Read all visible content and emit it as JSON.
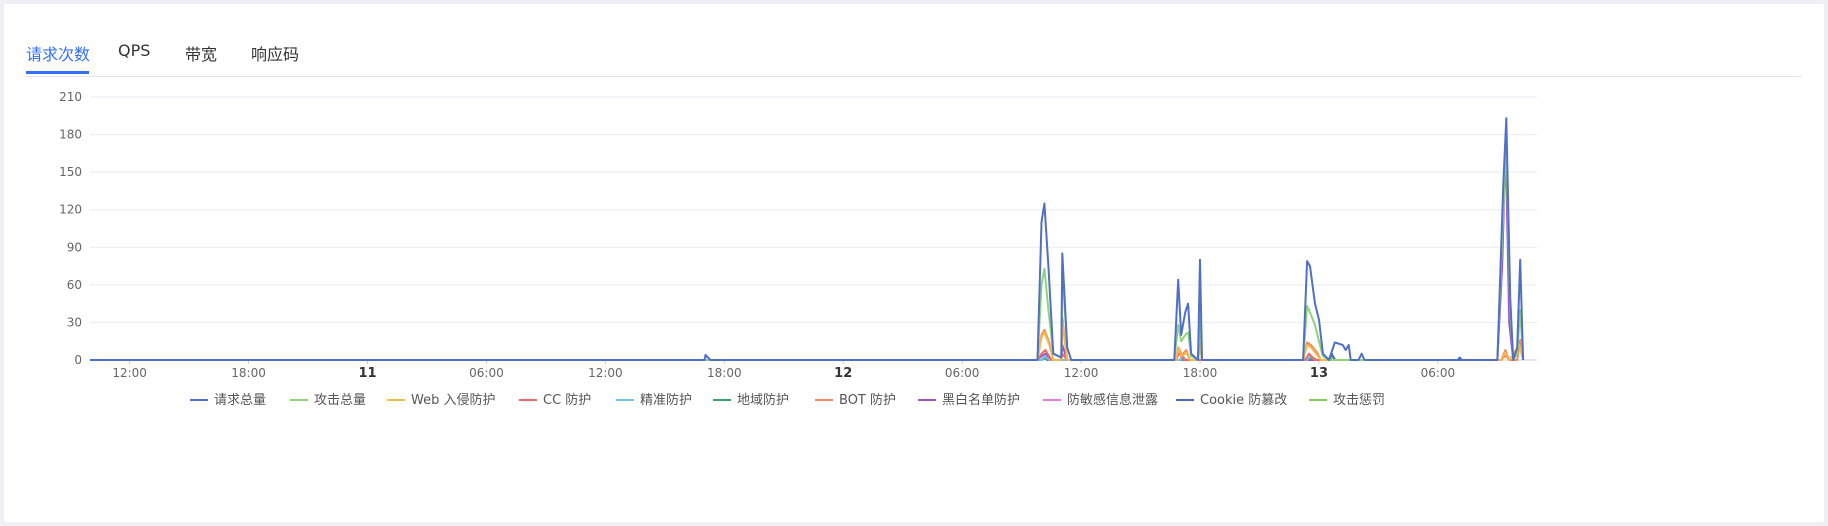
{
  "tabs": [
    {
      "label": "请求次数",
      "active": true
    },
    {
      "label": "QPS",
      "active": false
    },
    {
      "label": "带宽",
      "active": false
    },
    {
      "label": "响应码",
      "active": false
    }
  ],
  "colors": {
    "accent": "#3370ff",
    "grid": "#e8ebf0",
    "axis": "#c8ccd4"
  },
  "chart_data": {
    "type": "line",
    "y_ticks": [
      "0",
      "30",
      "60",
      "90",
      "120",
      "150",
      "180",
      "210"
    ],
    "ylim": [
      0,
      210
    ],
    "xlim": [
      0,
      60
    ],
    "x_ticks": [
      {
        "x": 2,
        "label": "12:00",
        "bold": false
      },
      {
        "x": 8,
        "label": "18:00",
        "bold": false
      },
      {
        "x": 14,
        "label": "11",
        "bold": true
      },
      {
        "x": 20,
        "label": "06:00",
        "bold": false
      },
      {
        "x": 26,
        "label": "12:00",
        "bold": false
      },
      {
        "x": 32,
        "label": "18:00",
        "bold": false
      },
      {
        "x": 38,
        "label": "12",
        "bold": true
      },
      {
        "x": 44,
        "label": "06:00",
        "bold": false
      },
      {
        "x": 50,
        "label": "12:00",
        "bold": false
      },
      {
        "x": 56,
        "label": "18:00",
        "bold": false
      },
      {
        "x": 62,
        "label": "13",
        "bold": true
      },
      {
        "x": 68,
        "label": "06:00",
        "bold": false
      }
    ],
    "series": [
      {
        "name": "请求总量",
        "color": "#4f6fc9",
        "points": [
          [
            0,
            0
          ],
          [
            31,
            0
          ],
          [
            31.05,
            4
          ],
          [
            31.3,
            0
          ],
          [
            47.8,
            0
          ],
          [
            48,
            110
          ],
          [
            48.15,
            125
          ],
          [
            48.35,
            75
          ],
          [
            48.6,
            5
          ],
          [
            49,
            2
          ],
          [
            49.05,
            85
          ],
          [
            49.3,
            10
          ],
          [
            49.5,
            0
          ],
          [
            54.7,
            0
          ],
          [
            54.9,
            64
          ],
          [
            55.05,
            20
          ],
          [
            55.25,
            38
          ],
          [
            55.4,
            45
          ],
          [
            55.55,
            5
          ],
          [
            55.9,
            0
          ],
          [
            56,
            80
          ],
          [
            56.1,
            0
          ],
          [
            61.2,
            0
          ],
          [
            61.4,
            79
          ],
          [
            61.55,
            75
          ],
          [
            61.8,
            45
          ],
          [
            62,
            32
          ],
          [
            62.2,
            5
          ],
          [
            62.5,
            0
          ],
          [
            62.8,
            14
          ],
          [
            63,
            13
          ],
          [
            63.2,
            12
          ],
          [
            63.35,
            8
          ],
          [
            63.5,
            12
          ],
          [
            63.6,
            0
          ],
          [
            64,
            0
          ],
          [
            64.15,
            5
          ],
          [
            64.3,
            0
          ],
          [
            71,
            0
          ],
          [
            71.3,
            140
          ],
          [
            71.45,
            193
          ],
          [
            71.65,
            50
          ],
          [
            71.8,
            0
          ],
          [
            72,
            10
          ],
          [
            72.15,
            80
          ],
          [
            72.3,
            0
          ]
        ]
      },
      {
        "name": "攻击总量",
        "color": "#8fd47a",
        "points": [
          [
            0,
            0
          ],
          [
            47.8,
            0
          ],
          [
            48,
            60
          ],
          [
            48.15,
            73
          ],
          [
            48.35,
            40
          ],
          [
            48.6,
            5
          ],
          [
            49,
            2
          ],
          [
            49.05,
            73
          ],
          [
            49.3,
            10
          ],
          [
            49.5,
            0
          ],
          [
            54.7,
            0
          ],
          [
            54.9,
            28
          ],
          [
            55.05,
            15
          ],
          [
            55.25,
            20
          ],
          [
            55.4,
            22
          ],
          [
            55.55,
            3
          ],
          [
            55.9,
            0
          ],
          [
            56,
            35
          ],
          [
            56.1,
            0
          ],
          [
            61.2,
            0
          ],
          [
            61.4,
            43
          ],
          [
            61.55,
            38
          ],
          [
            61.8,
            28
          ],
          [
            62,
            15
          ],
          [
            62.2,
            3
          ],
          [
            62.5,
            0
          ],
          [
            71,
            0
          ],
          [
            71.3,
            120
          ],
          [
            71.45,
            175
          ],
          [
            71.65,
            40
          ],
          [
            71.8,
            0
          ],
          [
            72,
            5
          ],
          [
            72.15,
            40
          ],
          [
            72.3,
            0
          ]
        ]
      },
      {
        "name": "Web 入侵防护",
        "color": "#f5b84b",
        "points": [
          [
            0,
            0
          ],
          [
            47.8,
            0
          ],
          [
            48,
            18
          ],
          [
            48.15,
            22
          ],
          [
            48.4,
            12
          ],
          [
            48.6,
            0
          ],
          [
            49,
            0
          ],
          [
            49.05,
            30
          ],
          [
            49.3,
            0
          ],
          [
            54.8,
            0
          ],
          [
            54.9,
            9
          ],
          [
            55.1,
            3
          ],
          [
            55.3,
            6
          ],
          [
            55.5,
            0
          ],
          [
            55.9,
            0
          ],
          [
            56,
            12
          ],
          [
            56.1,
            0
          ],
          [
            61.2,
            0
          ],
          [
            61.4,
            12
          ],
          [
            61.6,
            10
          ],
          [
            61.9,
            4
          ],
          [
            62.1,
            0
          ],
          [
            71.2,
            0
          ],
          [
            71.4,
            6
          ],
          [
            71.6,
            0
          ],
          [
            72.1,
            12
          ],
          [
            72.3,
            0
          ]
        ]
      },
      {
        "name": "CC 防护",
        "color": "#f06a6a",
        "points": [
          [
            0,
            0
          ],
          [
            47.8,
            0
          ],
          [
            48,
            5
          ],
          [
            48.2,
            8
          ],
          [
            48.5,
            0
          ],
          [
            49,
            0
          ],
          [
            49.05,
            5
          ],
          [
            49.3,
            0
          ],
          [
            54.8,
            0
          ],
          [
            54.95,
            6
          ],
          [
            55.2,
            0
          ],
          [
            61.3,
            0
          ],
          [
            61.5,
            5
          ],
          [
            61.8,
            0
          ],
          [
            71.2,
            0
          ],
          [
            71.4,
            4
          ],
          [
            71.6,
            0
          ]
        ]
      },
      {
        "name": "精准防护",
        "color": "#6fc3e8",
        "points": [
          [
            0,
            0
          ],
          [
            48,
            0
          ],
          [
            48.15,
            3
          ],
          [
            48.4,
            0
          ],
          [
            55,
            0
          ],
          [
            55.1,
            2
          ],
          [
            55.3,
            0
          ],
          [
            61.4,
            0
          ],
          [
            61.55,
            3
          ],
          [
            61.8,
            0
          ]
        ]
      },
      {
        "name": "地域防护",
        "color": "#3aa56e",
        "points": [
          [
            0,
            0
          ],
          [
            48,
            0
          ],
          [
            48.2,
            2
          ],
          [
            48.4,
            0
          ],
          [
            61.4,
            0
          ],
          [
            61.6,
            2
          ],
          [
            61.8,
            0
          ]
        ]
      },
      {
        "name": "BOT 防护",
        "color": "#f38a5c",
        "points": [
          [
            0,
            0
          ],
          [
            47.8,
            0
          ],
          [
            48,
            20
          ],
          [
            48.15,
            24
          ],
          [
            48.4,
            14
          ],
          [
            48.6,
            0
          ],
          [
            49,
            0
          ],
          [
            49.05,
            34
          ],
          [
            49.3,
            0
          ],
          [
            54.8,
            0
          ],
          [
            54.9,
            10
          ],
          [
            55.1,
            4
          ],
          [
            55.3,
            8
          ],
          [
            55.5,
            0
          ],
          [
            55.9,
            0
          ],
          [
            56,
            14
          ],
          [
            56.1,
            0
          ],
          [
            61.2,
            0
          ],
          [
            61.4,
            14
          ],
          [
            61.6,
            12
          ],
          [
            61.9,
            6
          ],
          [
            62.1,
            0
          ],
          [
            71.2,
            0
          ],
          [
            71.4,
            8
          ],
          [
            71.6,
            0
          ],
          [
            72,
            0
          ],
          [
            72.15,
            16
          ],
          [
            72.3,
            0
          ]
        ]
      },
      {
        "name": "黑白名单防护",
        "color": "#9a55c2",
        "points": [
          [
            0,
            0
          ],
          [
            47.8,
            0
          ],
          [
            48,
            3
          ],
          [
            48.2,
            5
          ],
          [
            48.5,
            0
          ],
          [
            49,
            0
          ],
          [
            49.05,
            12
          ],
          [
            49.3,
            0
          ],
          [
            55,
            0
          ],
          [
            55.1,
            3
          ],
          [
            55.3,
            0
          ],
          [
            71,
            0
          ],
          [
            71.25,
            78
          ],
          [
            71.35,
            138
          ],
          [
            71.45,
            150
          ],
          [
            71.6,
            30
          ],
          [
            71.8,
            0
          ]
        ]
      },
      {
        "name": "防敏感信息泄露",
        "color": "#f07ad2",
        "points": [
          [
            0,
            0
          ],
          [
            48,
            0
          ],
          [
            48.2,
            2
          ],
          [
            48.4,
            0
          ],
          [
            55,
            0
          ],
          [
            55.15,
            2
          ],
          [
            55.3,
            0
          ]
        ]
      },
      {
        "name": "Cookie 防篡改",
        "color": "#4a66c6",
        "points": [
          [
            0,
            0
          ],
          [
            48,
            0
          ],
          [
            48.15,
            2
          ],
          [
            48.3,
            0
          ],
          [
            61.5,
            0
          ],
          [
            61.65,
            2
          ],
          [
            61.8,
            0
          ],
          [
            62.5,
            0
          ],
          [
            62.65,
            5
          ],
          [
            62.8,
            0
          ],
          [
            69,
            0
          ],
          [
            69.1,
            2
          ],
          [
            69.2,
            0
          ]
        ]
      },
      {
        "name": "攻击惩罚",
        "color": "#7fcd5c",
        "points": [
          [
            0,
            0
          ],
          [
            48,
            0
          ],
          [
            48.2,
            2
          ],
          [
            48.4,
            0
          ],
          [
            61.5,
            0
          ],
          [
            61.7,
            2
          ],
          [
            61.9,
            0
          ],
          [
            62.6,
            0
          ],
          [
            62.7,
            3
          ],
          [
            62.85,
            0
          ]
        ]
      }
    ]
  }
}
